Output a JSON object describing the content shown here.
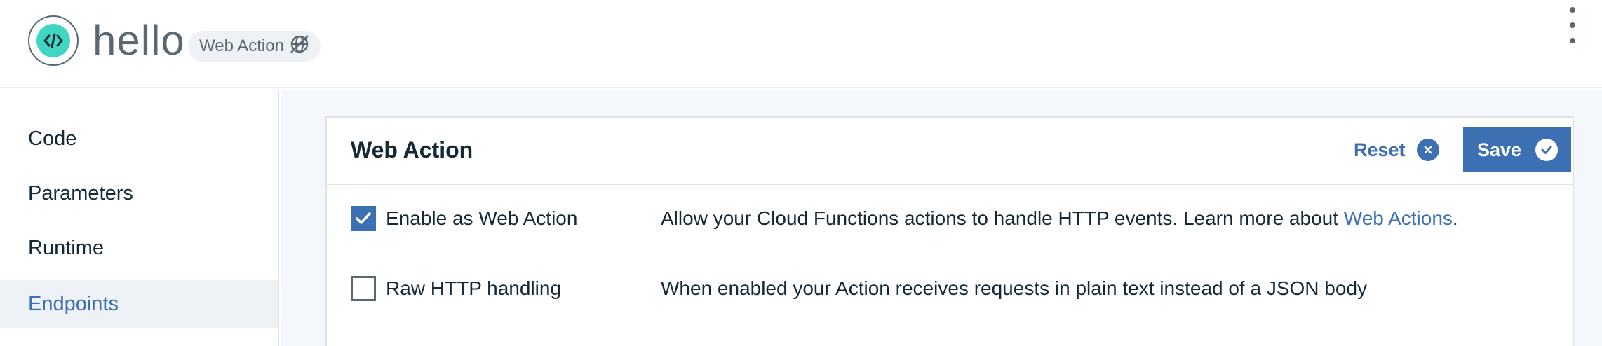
{
  "app": {
    "title": "hello",
    "badge_label": "Web Action",
    "badge_icon": "web-globe-icon",
    "logo_icon": "code-icon",
    "menu_icon": "overflow-menu-icon"
  },
  "sidebar": {
    "items": [
      {
        "label": "Code",
        "active": false
      },
      {
        "label": "Parameters",
        "active": false
      },
      {
        "label": "Runtime",
        "active": false
      },
      {
        "label": "Endpoints",
        "active": true
      }
    ]
  },
  "card": {
    "title": "Web Action",
    "reset_label": "Reset",
    "save_label": "Save"
  },
  "options": [
    {
      "label": "Enable as Web Action",
      "checked": true,
      "description": "Allow your Cloud Functions actions to handle HTTP events. Learn more about ",
      "link_text": "Web Actions",
      "description_suffix": "."
    },
    {
      "label": "Raw HTTP handling",
      "checked": false,
      "description": "When enabled your Action receives requests in plain text instead of a JSON body"
    }
  ],
  "colors": {
    "accent": "#3d70b2",
    "logo_teal": "#41d6c3",
    "text": "#152935",
    "muted": "#5a6872",
    "background": "#f4f7fb"
  }
}
